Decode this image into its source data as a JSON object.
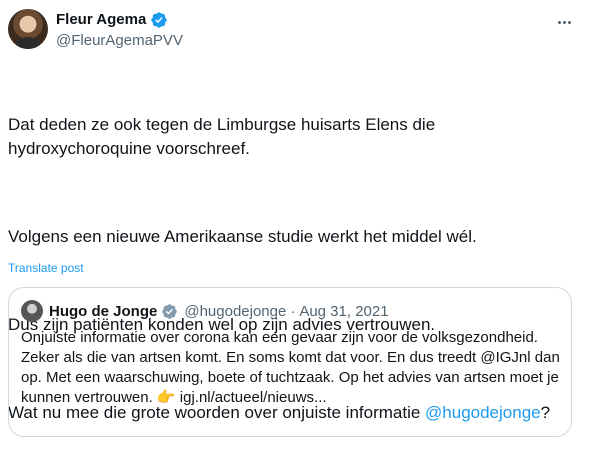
{
  "author": {
    "name": "Fleur Agema",
    "handle": "@FleurAgemaPVV"
  },
  "tweet": {
    "p1": "Dat deden ze ook tegen de Limburgse huisarts Elens die\nhydroxychoroquine voorschreef.",
    "p2": "Volgens een nieuwe Amerikaanse studie werkt het middel wél.",
    "p3": "Dus zijn patiënten konden wel op zijn advies vertrouwen.",
    "p4_prefix": "Wat nu mee die grote woorden over onjuiste informatie ",
    "p4_mention": "@hugodejonge",
    "p4_suffix": "?"
  },
  "translate_label": "Translate post",
  "quote": {
    "name": "Hugo de Jonge",
    "handle": "@hugodejonge",
    "separator": "·",
    "date": "Aug 31, 2021",
    "text": "Onjuiste informatie over corona kan een gevaar zijn voor de volksgezondheid. Zeker als die van artsen komt. En soms komt dat voor. En dus treedt @IGJnl dan op. Met een waarschuwing, boete of tuchtzaak. Op het advies van artsen moet je kunnen vertrouwen. ",
    "emoji": "👉",
    "link": " igj.nl/actueel/nieuws..."
  },
  "colors": {
    "accent": "#1d9bf0",
    "secondary_text": "#536471",
    "border": "#cfd9de"
  },
  "icons": [
    "verified-badge-icon",
    "more-options-icon"
  ]
}
